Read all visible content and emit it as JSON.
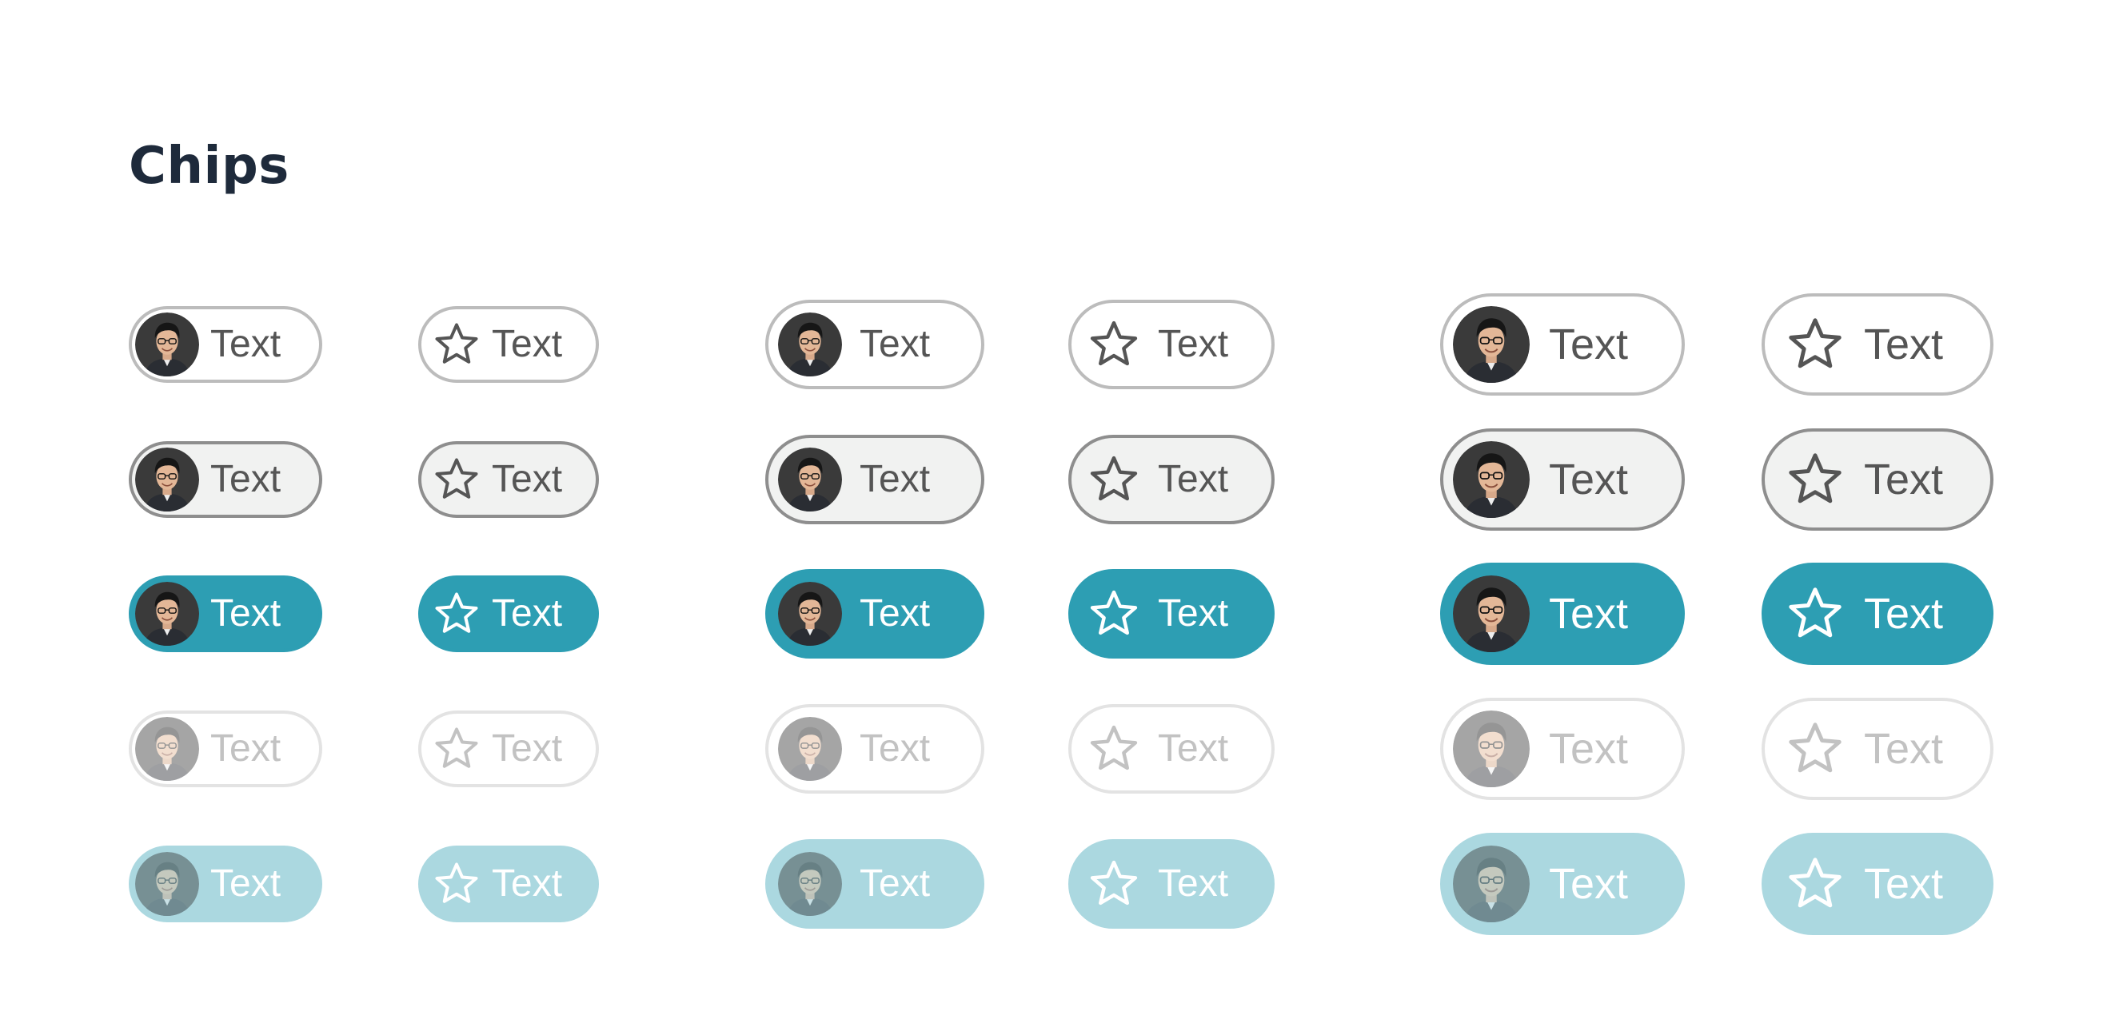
{
  "page": {
    "title": "Chips"
  },
  "chip": {
    "label": "Text"
  },
  "sizes": [
    "small",
    "medium",
    "large"
  ],
  "states": [
    "default",
    "hover",
    "selected",
    "disabled",
    "disabled-selected"
  ],
  "variants": [
    "avatar",
    "icon"
  ],
  "icons": {
    "leading_icon": "star-icon",
    "leading_avatar": "avatar"
  },
  "colors": {
    "title_text": "#1e2a3b",
    "chip_text": "#555555",
    "default_border": "#bcbcbc",
    "hover_background": "#f1f2f1",
    "hover_border": "#8e8e8e",
    "selected_background": "#2d9eb3",
    "disabled_border": "#e3e3e3",
    "disabled_text": "#c2c2c2",
    "disabled_selected_background": "#abd8e0"
  }
}
